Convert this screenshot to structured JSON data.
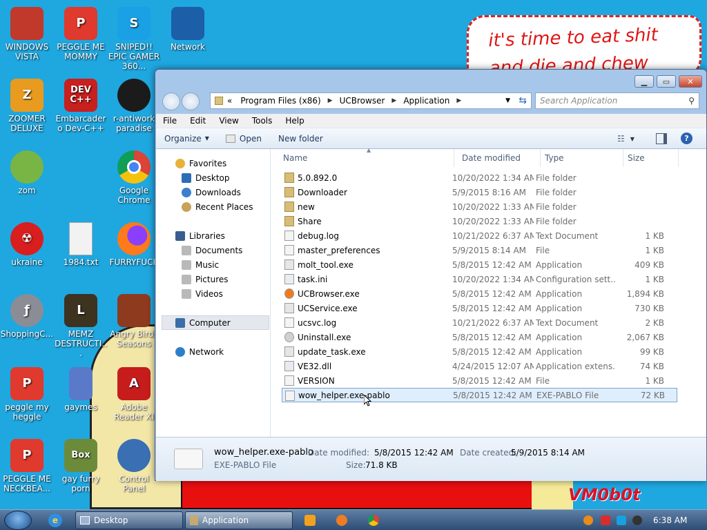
{
  "wallpaper": {
    "sign_lines": [
      "it's time to eat shit",
      "and die and chew"
    ],
    "brand": "VM0b0t"
  },
  "desktop_icons": [
    {
      "label": "WINDOWS VISTA",
      "icon": "red-helmet-icon",
      "color": "#c0392b"
    },
    {
      "label": "PEGGLE ME MOMMY",
      "icon": "peggle-p-icon",
      "color": "#e0392d"
    },
    {
      "label": "SNIPED!! EPIC GAMER 360...",
      "icon": "skype-s-icon",
      "color": "#1aa0e4"
    },
    {
      "label": "Network",
      "icon": "network-globe-icon",
      "color": "#1d5ea8"
    },
    {
      "label": "ZOOMER DELUXE",
      "icon": "zoomer-z-icon",
      "color": "#e89b1e"
    },
    {
      "label": "Embarcadero Dev-C++",
      "icon": "devcpp-icon",
      "color": "#c81f1f"
    },
    {
      "label": "r-antiwork paradise",
      "icon": "antiwork-icon",
      "color": "#1b1b1b"
    },
    {
      "label": "zom",
      "icon": "plant-icon",
      "color": "#79b545"
    },
    {
      "label": "Google Chrome",
      "icon": "chrome-icon",
      "color": "#2fa750"
    },
    {
      "label": "ukraine",
      "icon": "radiation-icon",
      "color": "#d81e1e"
    },
    {
      "label": "1984.txt",
      "icon": "text-file-icon",
      "color": "#f2f2f2"
    },
    {
      "label": "FURRYFUCK",
      "icon": "firefox-icon",
      "color": "#ff7a1a"
    },
    {
      "label": "ShoppingC...",
      "icon": "flash-icon",
      "color": "#8a8d95"
    },
    {
      "label": "MEMZ DESTRUCTI...",
      "icon": "memz-clock-icon",
      "color": "#3d3320"
    },
    {
      "label": "Angry Birds Seasons",
      "icon": "angry-birds-icon",
      "color": "#8e3a1e"
    },
    {
      "label": "peggle my heggle",
      "icon": "peggle-p-icon",
      "color": "#e0392d"
    },
    {
      "label": "gaymes",
      "icon": "games-folder-icon",
      "color": "#5a79c8"
    },
    {
      "label": "Adobe Reader XI",
      "icon": "adobe-reader-icon",
      "color": "#c71c1c"
    },
    {
      "label": "PEGGLE ME NECKBEA...",
      "icon": "peggle-p-icon",
      "color": "#e0392d"
    },
    {
      "label": "gay furry porn",
      "icon": "bonzi-box-icon",
      "color": "#6c8b3a"
    },
    {
      "label": "Control Panel",
      "icon": "control-panel-icon",
      "color": "#3b6fb4"
    }
  ],
  "explorer": {
    "address": {
      "overflow": "«",
      "crumbs": [
        "Program Files (x86)",
        "UCBrowser",
        "Application"
      ]
    },
    "search_placeholder": "Search Application",
    "menu": [
      "File",
      "Edit",
      "View",
      "Tools",
      "Help"
    ],
    "toolbar": {
      "organize": "Organize",
      "open": "Open",
      "new_folder": "New folder"
    },
    "nav": {
      "favorites": "Favorites",
      "favorites_items": [
        "Desktop",
        "Downloads",
        "Recent Places"
      ],
      "libraries": "Libraries",
      "libraries_items": [
        "Documents",
        "Music",
        "Pictures",
        "Videos"
      ],
      "computer": "Computer",
      "network": "Network"
    },
    "columns": {
      "name": "Name",
      "date": "Date modified",
      "type": "Type",
      "size": "Size"
    },
    "files": [
      {
        "name": "5.0.892.0",
        "date": "10/20/2022 1:34 AM",
        "type": "File folder",
        "size": "",
        "icon": "folder-icon"
      },
      {
        "name": "Downloader",
        "date": "5/9/2015 8:16 AM",
        "type": "File folder",
        "size": "",
        "icon": "folder-icon"
      },
      {
        "name": "new",
        "date": "10/20/2022 1:33 AM",
        "type": "File folder",
        "size": "",
        "icon": "folder-icon"
      },
      {
        "name": "Share",
        "date": "10/20/2022 1:33 AM",
        "type": "File folder",
        "size": "",
        "icon": "folder-icon"
      },
      {
        "name": "debug.log",
        "date": "10/21/2022 6:37 AM",
        "type": "Text Document",
        "size": "1 KB",
        "icon": "text-file-icon"
      },
      {
        "name": "master_preferences",
        "date": "5/9/2015 8:14 AM",
        "type": "File",
        "size": "1 KB",
        "icon": "generic-file-icon"
      },
      {
        "name": "molt_tool.exe",
        "date": "5/8/2015 12:42 AM",
        "type": "Application",
        "size": "409 KB",
        "icon": "exe-icon"
      },
      {
        "name": "task.ini",
        "date": "10/20/2022 1:34 AM",
        "type": "Configuration sett...",
        "size": "1 KB",
        "icon": "ini-file-icon"
      },
      {
        "name": "UCBrowser.exe",
        "date": "5/8/2015 12:42 AM",
        "type": "Application",
        "size": "1,894 KB",
        "icon": "ucbrowser-icon"
      },
      {
        "name": "UCService.exe",
        "date": "5/8/2015 12:42 AM",
        "type": "Application",
        "size": "730 KB",
        "icon": "exe-icon"
      },
      {
        "name": "ucsvc.log",
        "date": "10/21/2022 6:37 AM",
        "type": "Text Document",
        "size": "2 KB",
        "icon": "text-file-icon"
      },
      {
        "name": "Uninstall.exe",
        "date": "5/8/2015 12:42 AM",
        "type": "Application",
        "size": "2,067 KB",
        "icon": "trash-icon"
      },
      {
        "name": "update_task.exe",
        "date": "5/8/2015 12:42 AM",
        "type": "Application",
        "size": "99 KB",
        "icon": "exe-icon"
      },
      {
        "name": "VE32.dll",
        "date": "4/24/2015 12:07 AM",
        "type": "Application extens...",
        "size": "74 KB",
        "icon": "dll-icon"
      },
      {
        "name": "VERSION",
        "date": "5/8/2015 12:42 AM",
        "type": "File",
        "size": "1 KB",
        "icon": "generic-file-icon"
      },
      {
        "name": "wow_helper.exe-pablo",
        "date": "5/8/2015 12:42 AM",
        "type": "EXE-PABLO File",
        "size": "72 KB",
        "icon": "generic-file-icon",
        "selected": true
      }
    ],
    "details": {
      "filename": "wow_helper.exe-pablo",
      "filetype": "EXE-PABLO File",
      "modified_label": "Date modified:",
      "modified_value": "5/8/2015 12:42 AM",
      "created_label": "Date created:",
      "created_value": "5/9/2015 8:14 AM",
      "size_label": "Size:",
      "size_value": "71.8 KB"
    }
  },
  "taskbar": {
    "buttons": [
      "Desktop",
      "Application"
    ],
    "clock": "6:38 AM"
  }
}
